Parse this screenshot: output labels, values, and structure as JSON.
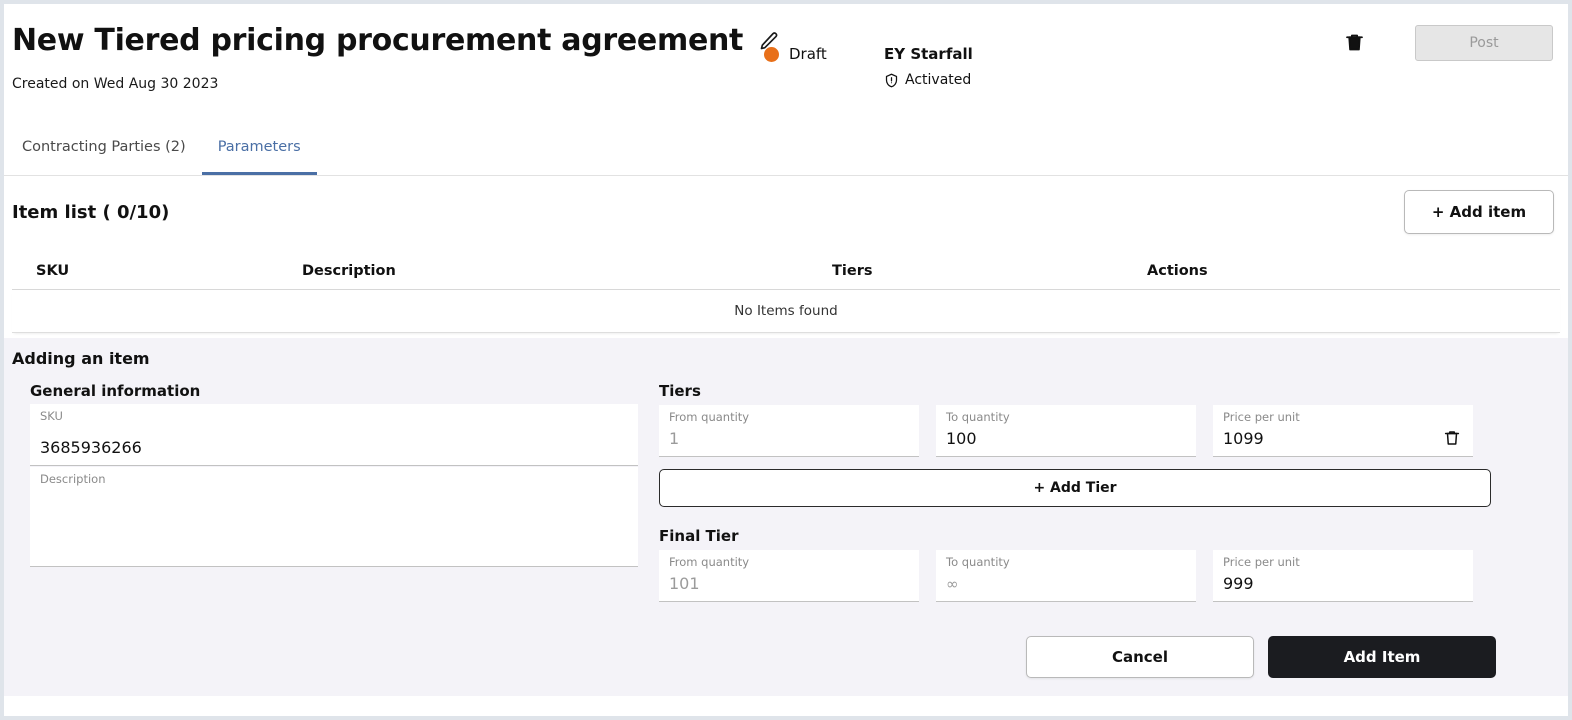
{
  "header": {
    "title": "New Tiered pricing procurement agreement",
    "edit_icon": "pencil-icon",
    "created_on": "Created on Wed Aug 30 2023",
    "status": "Draft",
    "status_color": "#e8701a",
    "org_name": "EY Starfall",
    "org_state": "Activated",
    "org_state_icon": "shield-alert-icon",
    "delete_icon": "trash-icon",
    "post_label": "Post"
  },
  "tabs": [
    {
      "label": "Contracting Parties (2)",
      "active": false
    },
    {
      "label": "Parameters",
      "active": true
    }
  ],
  "item_list": {
    "title": "Item list ( 0/10)",
    "add_item_label": "+ Add item",
    "columns": [
      "SKU",
      "Description",
      "Tiers",
      "Actions"
    ],
    "empty_text": "No Items found"
  },
  "adding_item": {
    "panel_title": "Adding an item",
    "general": {
      "section_title": "General information",
      "sku_label": "SKU",
      "sku_value": "3685936266",
      "description_label": "Description",
      "description_value": ""
    },
    "tiers": {
      "section_title": "Tiers",
      "from_label": "From quantity",
      "to_label": "To quantity",
      "price_label": "Price per unit",
      "rows": [
        {
          "from": "1",
          "to": "100",
          "price": "1099",
          "delete_icon": "trash-icon"
        }
      ],
      "add_tier_label": "+ Add Tier"
    },
    "final_tier": {
      "section_title": "Final Tier",
      "from_label": "From quantity",
      "to_label": "To quantity",
      "price_label": "Price per unit",
      "from": "101",
      "to": "∞",
      "price": "999"
    },
    "cancel_label": "Cancel",
    "submit_label": "Add Item"
  }
}
